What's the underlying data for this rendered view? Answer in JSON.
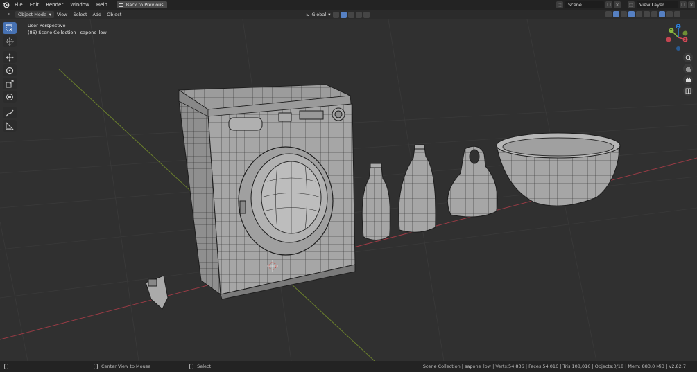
{
  "menu": {
    "file": "File",
    "edit": "Edit",
    "render": "Render",
    "window": "Window",
    "help": "Help",
    "back_button": "Back to Previous"
  },
  "scene": {
    "name": "Scene"
  },
  "view_layer": {
    "name": "View Layer"
  },
  "viewport_header": {
    "mode": "Object Mode",
    "view": "View",
    "select": "Select",
    "add": "Add",
    "object": "Object",
    "orientation": "Global"
  },
  "viewport": {
    "perspective_label": "User Perspective",
    "collection_label": "(86) Scene Collection | sapone_low"
  },
  "gizmo": {
    "x": "X",
    "y": "Y",
    "z": "Z"
  },
  "statusbar": {
    "center_view": "Center View to Mouse",
    "select": "Select",
    "stats": "Scene Collection | sapone_low | Verts:54,836 | Faces:54,016 | Tris:108,016 | Objects:0/18 | Mem: 883.0 MiB | v2.82.7"
  },
  "colors": {
    "accent": "#4772b3",
    "axis_x": "#d24b58",
    "axis_y": "#8ab83e",
    "axis_z": "#2f7fd9",
    "background": "#303030"
  },
  "icons": [
    "blender-logo-icon",
    "select-box-icon",
    "cursor-icon",
    "move-icon",
    "rotate-icon",
    "scale-icon",
    "transform-icon",
    "annotate-icon",
    "measure-icon",
    "zoom-icon",
    "hand-pan-icon",
    "camera-icon",
    "grid-icon"
  ]
}
